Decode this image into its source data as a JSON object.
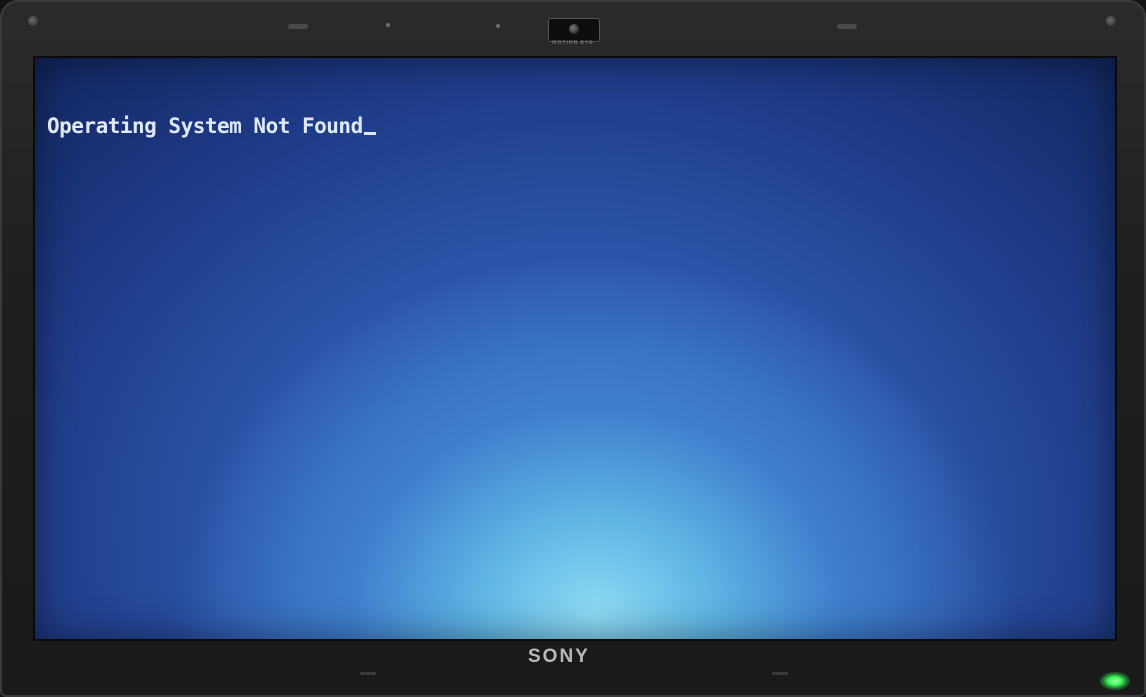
{
  "screen": {
    "message": "Operating System Not Found",
    "background_color": "#2c54a8",
    "highlight_color": "#8fdcf5",
    "text_color": "#dfe8f6"
  },
  "bezel": {
    "brand": "SONY",
    "camera_label": "MOTION EYE",
    "power_led_color": "#3cff5a"
  }
}
